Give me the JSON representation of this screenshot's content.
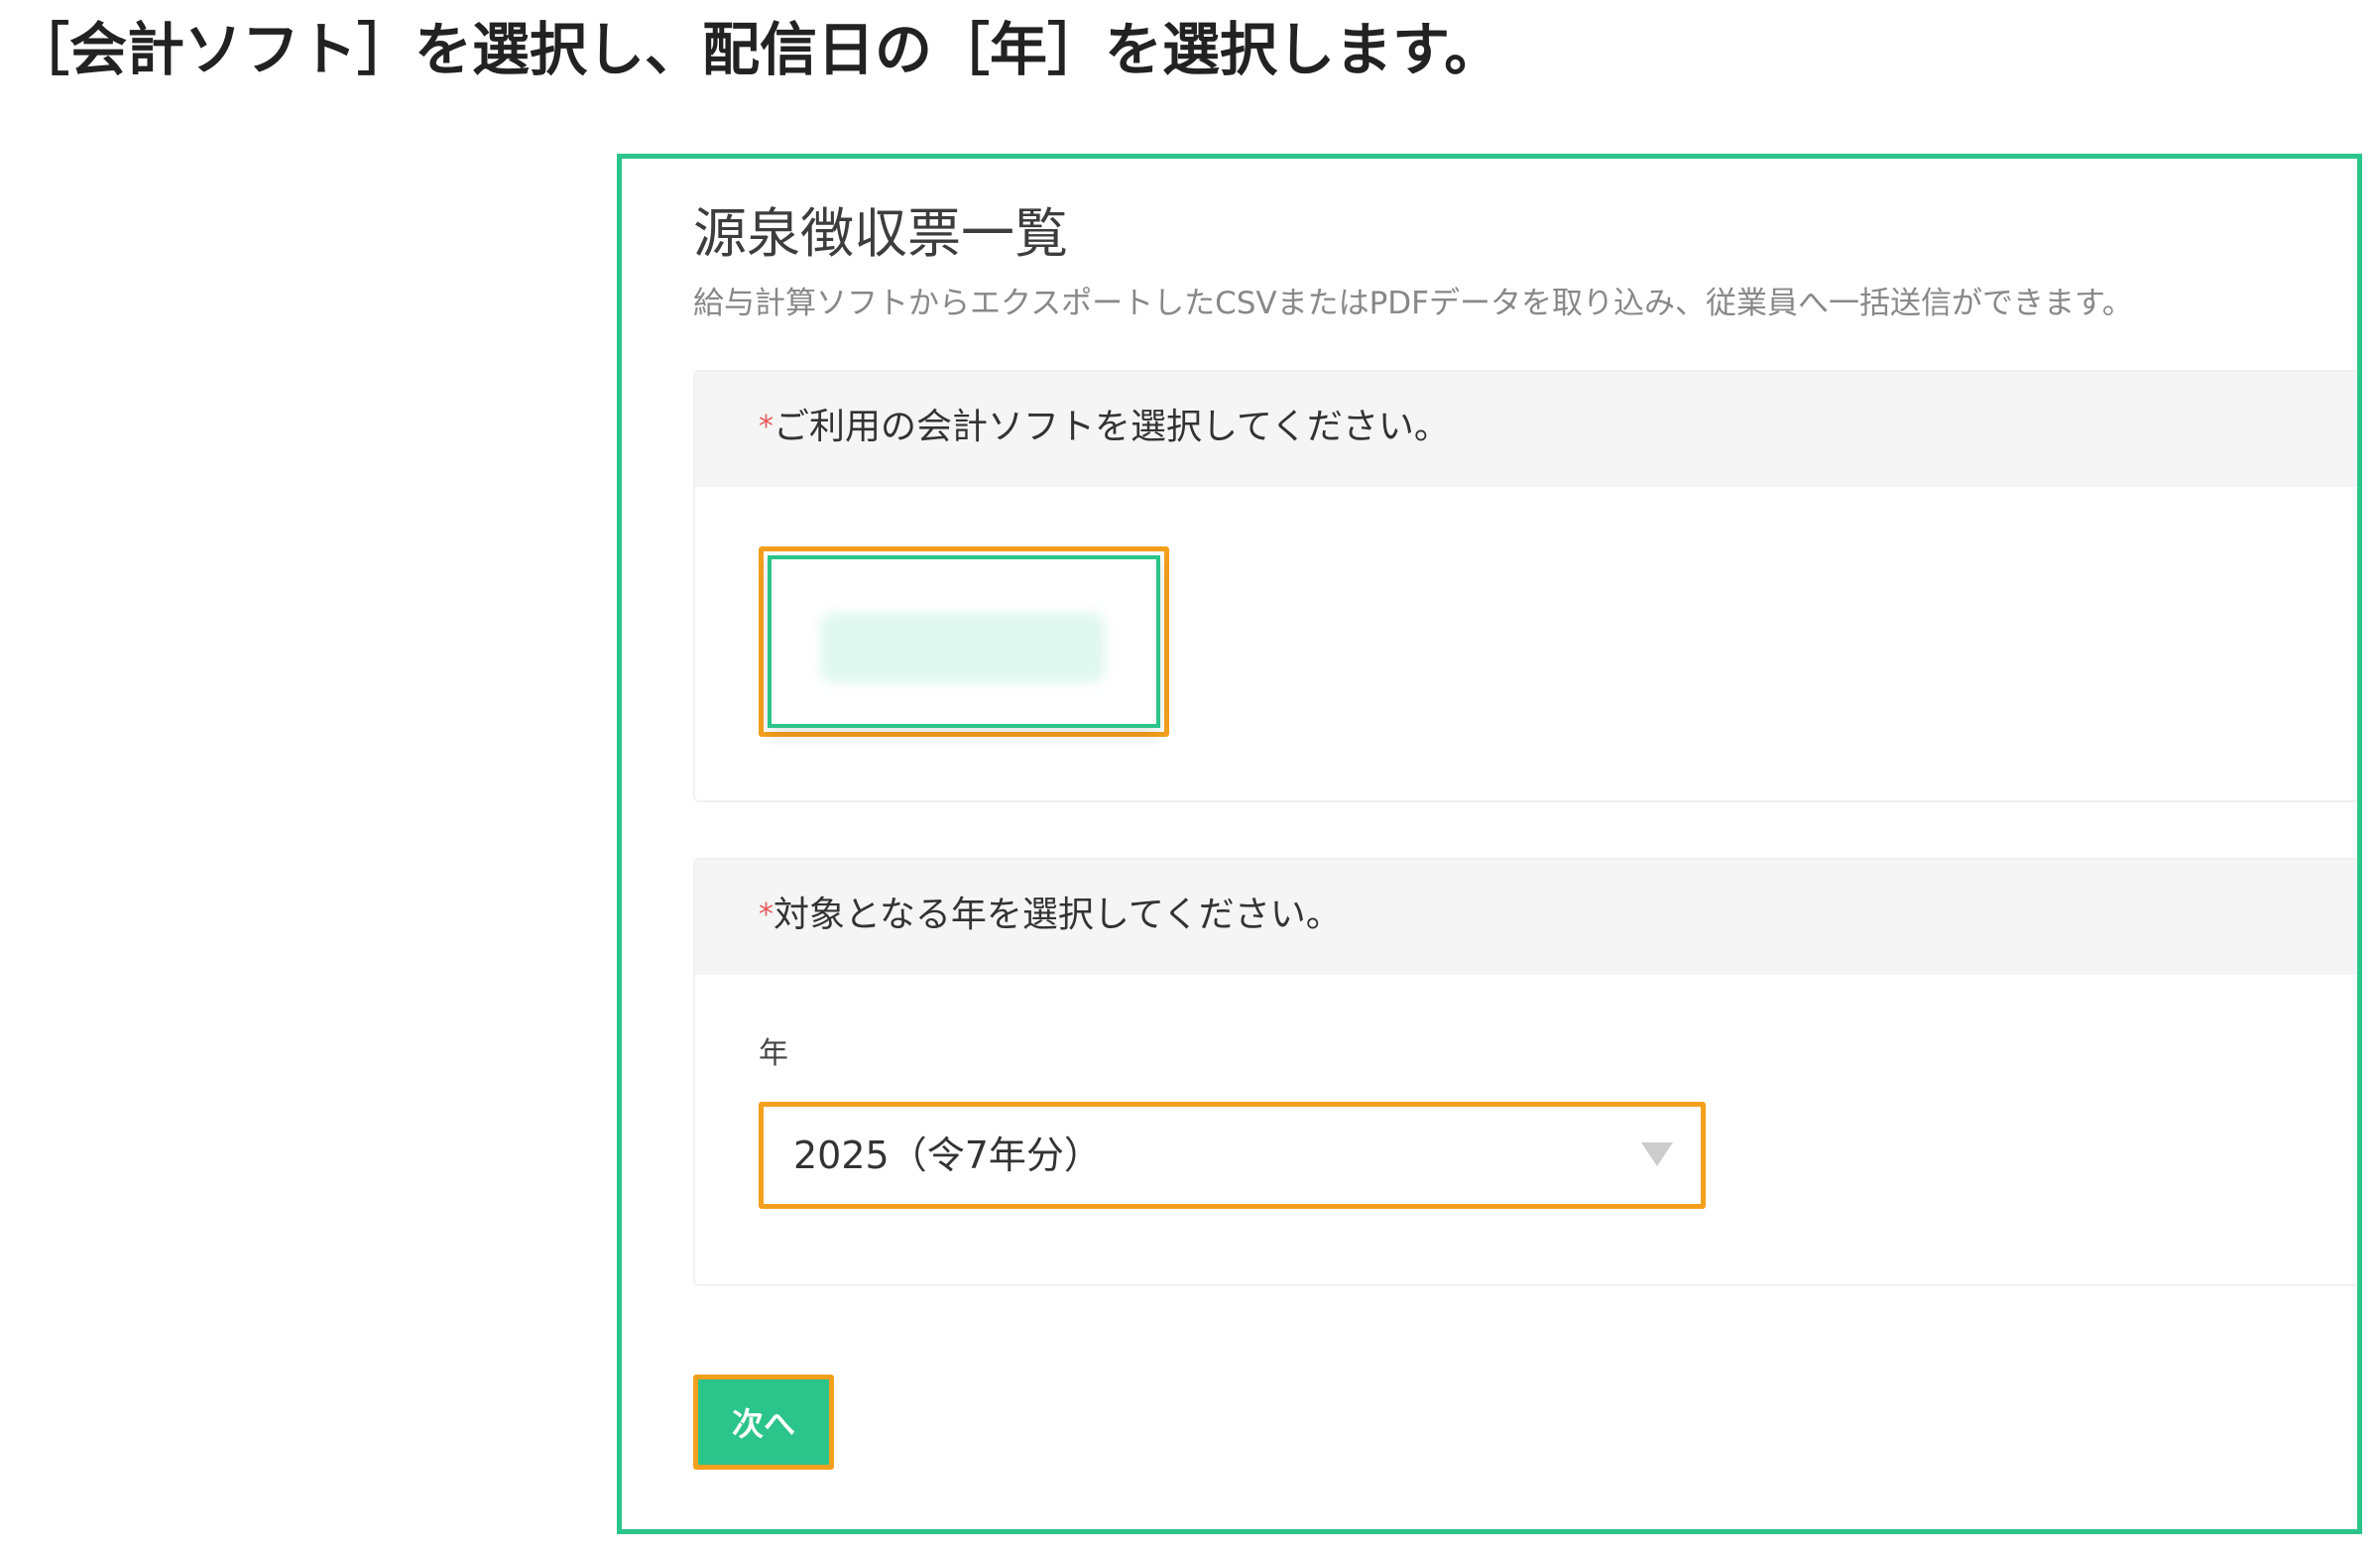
{
  "instruction": "［会計ソフト］を選択し、配信日の［年］を選択します。",
  "page": {
    "title": "源泉徴収票一覧",
    "description": "給与計算ソフトからエクスポートしたCSVまたはPDFデータを取り込み、従業員へ一括送信ができます。"
  },
  "software_section": {
    "required_mark": "*",
    "label": "ご利用の会計ソフトを選択してください。"
  },
  "year_section": {
    "required_mark": "*",
    "label": "対象となる年を選択してください。",
    "field_label": "年",
    "selected_value": "2025（令7年分）"
  },
  "next_button": {
    "label": "次へ"
  },
  "colors": {
    "frame_border": "#2bc48a",
    "highlight_border": "#f5a01d",
    "primary_button": "#2bc48a",
    "required_mark": "#e65a5a"
  }
}
